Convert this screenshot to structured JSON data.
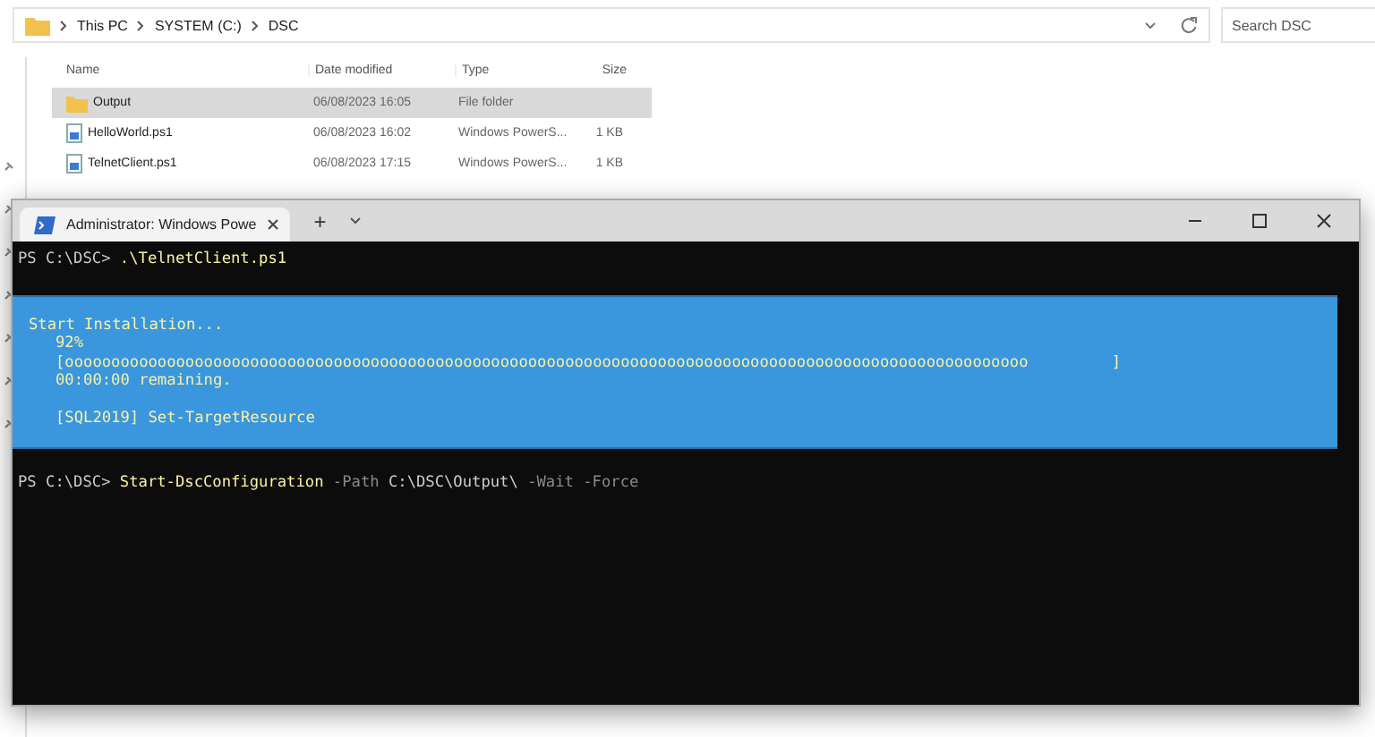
{
  "explorer": {
    "breadcrumbs": [
      "This PC",
      "SYSTEM (C:)",
      "DSC"
    ],
    "search": {
      "placeholder": "Search DSC"
    },
    "columns": [
      "Name",
      "Date modified",
      "Type",
      "Size"
    ],
    "rows": [
      {
        "kind": "folder",
        "name": "Output",
        "date": "06/08/2023 16:05",
        "type": "File folder",
        "size": "",
        "selected": true
      },
      {
        "kind": "script",
        "name": "HelloWorld.ps1",
        "date": "06/08/2023 16:02",
        "type": "Windows PowerS...",
        "size": "1 KB",
        "selected": false
      },
      {
        "kind": "script",
        "name": "TelnetClient.ps1",
        "date": "06/08/2023 17:15",
        "type": "Windows PowerS...",
        "size": "1 KB",
        "selected": false
      }
    ]
  },
  "terminal": {
    "tab_title": "Administrator: Windows Powe",
    "new_tab": "+",
    "lines": [
      [
        {
          "kind": "prompt",
          "text": "PS C:\\DSC> "
        },
        {
          "kind": "command",
          "text": ".\\TelnetClient.ps1"
        }
      ]
    ],
    "progress": {
      "activity": "Start Installation...",
      "percent": "92%",
      "bar": "[oooooooooooooooooooooooooooooooooooooooooooooooooooooooooooooooooooooooooooooooooooooooooooooooooooooooo         ]",
      "remaining": "00:00:00 remaining.",
      "status": "[SQL2019] Set-TargetResource"
    },
    "current": [
      {
        "kind": "prompt",
        "text": "PS C:\\DSC> "
      },
      {
        "kind": "command",
        "text": "Start-DscConfiguration"
      },
      {
        "kind": "param",
        "text": " -Path "
      },
      {
        "kind": "arg",
        "text": "C:\\DSC\\Output\\"
      },
      {
        "kind": "param",
        "text": " -Wait -Force"
      }
    ]
  }
}
